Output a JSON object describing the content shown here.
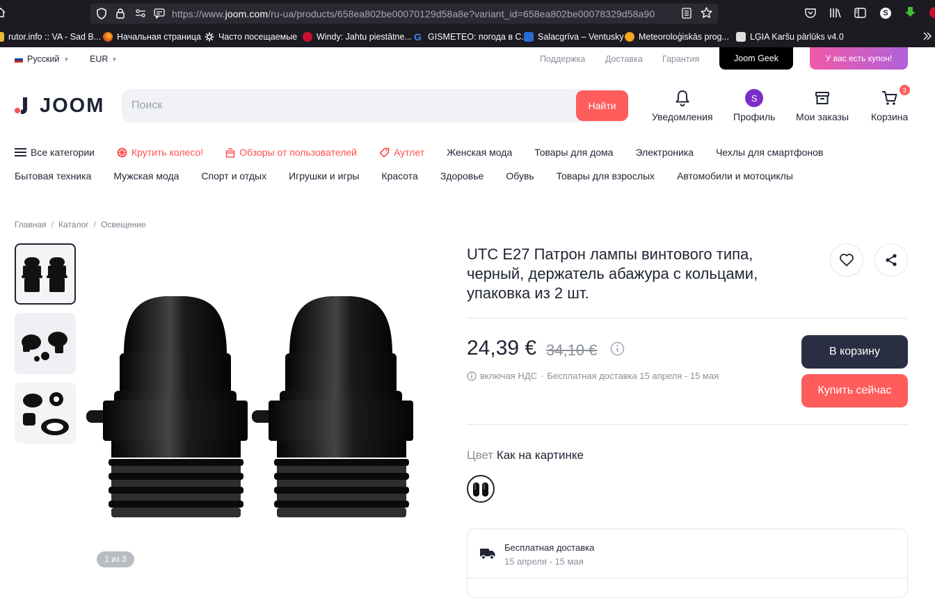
{
  "browser": {
    "url_prefix": "https://www.",
    "url_host": "joom.com",
    "url_path": "/ru-ua/products/658ea802be00070129d58a8e?variant_id=658ea802be00078329d58a90",
    "profile_letter": "S",
    "bookmarks": [
      {
        "label": "rutor.info :: VA - Sad B...",
        "color": "#e8b93a"
      },
      {
        "label": "Начальная страница",
        "color": "#e66000"
      },
      {
        "label": "Часто посещаемые",
        "color": "#fbfbfe"
      },
      {
        "label": "Windy: Jahtu piestātne...",
        "color": "#c8102e"
      },
      {
        "label": "GISMETEO: погода в С...",
        "color": "#3b82f6"
      },
      {
        "label": "Salacgrīva – Ventusky",
        "color": "#2a6bd1"
      },
      {
        "label": "Meteoroloģiskās prog...",
        "color": "#f5a623"
      },
      {
        "label": "LĢIA Karšu pārlūks v4.0",
        "color": "#e0e0e0"
      }
    ]
  },
  "topbar": {
    "language": "Русский",
    "currency": "EUR",
    "links": [
      "Поддержка",
      "Доставка",
      "Гарантия"
    ],
    "geek_label": "Joom Geek",
    "coupon_label": "У вас есть купон!"
  },
  "header": {
    "logo_text": "JOOM",
    "search_placeholder": "Поиск",
    "search_button": "Найти",
    "notifications_label": "Уведомления",
    "profile_label": "Профиль",
    "profile_initial": "S",
    "orders_label": "Мои заказы",
    "cart_label": "Корзина",
    "cart_count": "3"
  },
  "nav": {
    "row1": [
      {
        "label": "Все категории",
        "icon": "menu-icon",
        "style": "normal"
      },
      {
        "label": "Крутить колесо!",
        "icon": "wheel-icon",
        "style": "red"
      },
      {
        "label": "Обзоры от пользователей",
        "icon": "gift-icon",
        "style": "red"
      },
      {
        "label": "Аутлет",
        "icon": "tag-icon",
        "style": "red"
      },
      {
        "label": "Женская мода",
        "style": "normal"
      },
      {
        "label": "Товары для дома",
        "style": "normal"
      },
      {
        "label": "Электроника",
        "style": "normal"
      },
      {
        "label": "Чехлы для смартфонов",
        "style": "normal"
      }
    ],
    "row2": [
      "Бытовая техника",
      "Мужская мода",
      "Спорт и отдых",
      "Игрушки и игры",
      "Красота",
      "Здоровье",
      "Обувь",
      "Товары для взрослых",
      "Автомобили и мотоциклы"
    ]
  },
  "breadcrumbs": [
    "Главная",
    "Каталог",
    "Освещение"
  ],
  "gallery": {
    "counter": "1 из 3",
    "thumbnail_count": 3
  },
  "product": {
    "title": "UTC E27 Патрон лампы винтового типа, черный, держатель абажура с кольцами, упаковка из 2 шт.",
    "price": "24,39 €",
    "old_price": "34,10 €",
    "vat_text": "включая НДС",
    "delivery_inline": "Бесплатная доставка 15 апреля - 15 мая",
    "add_to_cart": "В корзину",
    "buy_now": "Купить сейчас",
    "color_label": "Цвет",
    "color_value": "Как на картинке",
    "delivery_title": "Бесплатная доставка",
    "delivery_dates": "15 апреля - 15 мая"
  },
  "colors": {
    "accent_red": "#ff5c5c",
    "dark_button": "#292e42",
    "profile_purple": "#7a2ec7"
  }
}
